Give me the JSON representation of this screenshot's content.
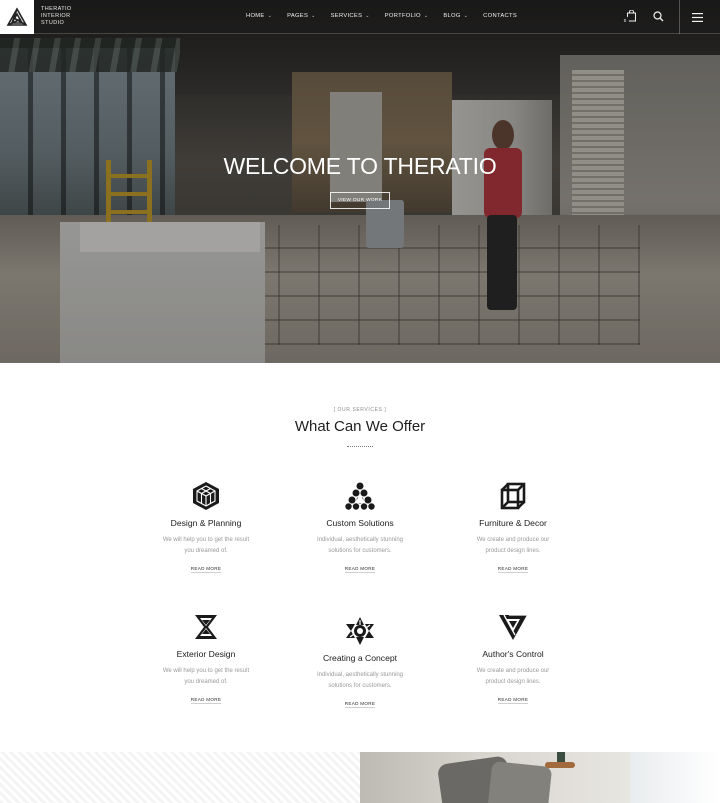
{
  "header": {
    "logo_lines": [
      "THERATIO",
      "INTERIOR",
      "STUDIO"
    ],
    "nav": [
      {
        "label": "HOME",
        "has_dropdown": true
      },
      {
        "label": "PAGES",
        "has_dropdown": true
      },
      {
        "label": "SERVICES",
        "has_dropdown": true
      },
      {
        "label": "PORTFOLIO",
        "has_dropdown": true
      },
      {
        "label": "BLOG",
        "has_dropdown": true
      },
      {
        "label": "CONTACTS",
        "has_dropdown": false
      }
    ],
    "cart_count": "0",
    "icons": [
      "cart-icon",
      "search-icon",
      "menu-icon"
    ]
  },
  "hero": {
    "title": "WELCOME TO THERATIO",
    "button_label": "VIEW OUR WORK"
  },
  "services": {
    "kicker": "[ OUR SERVICES ]",
    "title": "What Can We Offer",
    "read_more_label": "READ MORE",
    "items": [
      {
        "icon": "cube-grid-icon",
        "name": "Design & Planning",
        "desc_line1": "We will help you to get the result",
        "desc_line2": "you dreamed of."
      },
      {
        "icon": "triangle-spheres-icon",
        "name": "Custom Solutions",
        "desc_line1": "Individual, aesthetically stunning",
        "desc_line2": "solutions for customers."
      },
      {
        "icon": "wire-cube-icon",
        "name": "Furniture & Decor",
        "desc_line1": "We create and produce our",
        "desc_line2": "product design lines."
      },
      {
        "icon": "hourglass-icon",
        "name": "Exterior Design",
        "desc_line1": "We will help you to get the result",
        "desc_line2": "you dreamed of."
      },
      {
        "icon": "star-knot-icon",
        "name": "Creating a Concept",
        "desc_line1": "Individual, aesthetically stunning",
        "desc_line2": "solutions for customers."
      },
      {
        "icon": "triangle-knot-icon",
        "name": "Author's Control",
        "desc_line1": "We create and produce our",
        "desc_line2": "product design lines."
      }
    ]
  },
  "colors": {
    "accent": "#1b1b1b",
    "text_muted": "#9a9a9a",
    "hero_overlay": "#0a0a0a"
  }
}
